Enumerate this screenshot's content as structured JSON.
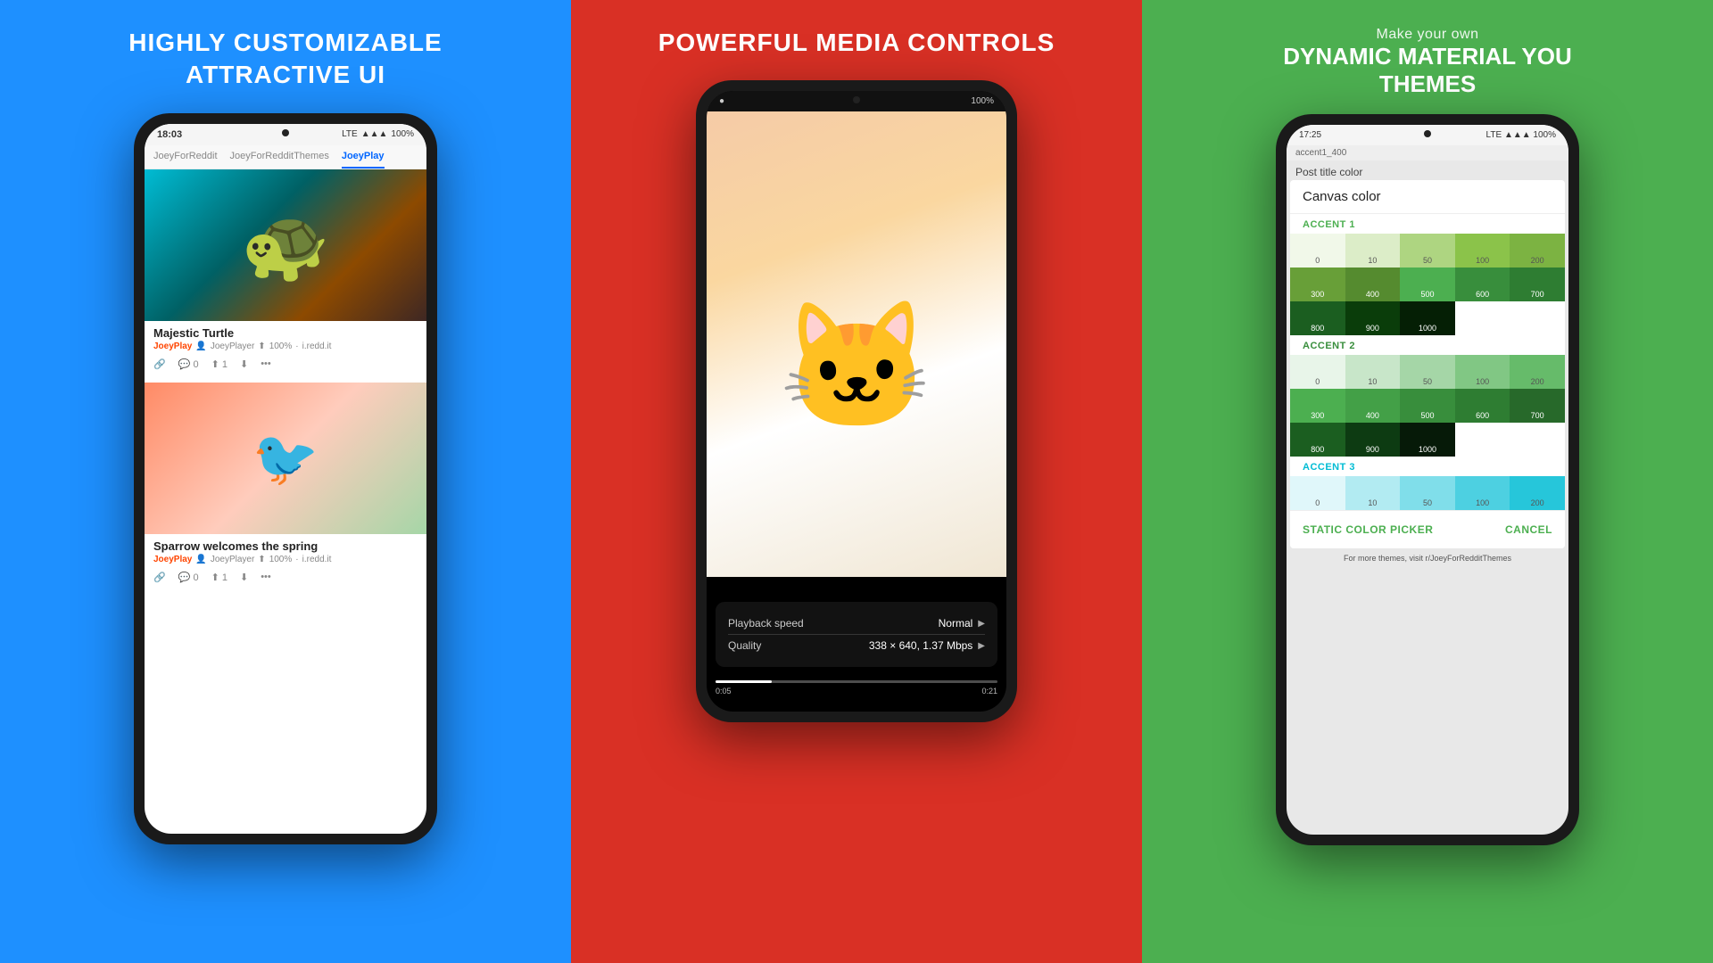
{
  "panel1": {
    "title_line1": "HIGHLY CUSTOMIZABLE",
    "title_line2": "ATTRACTIVE UI",
    "background_color": "#1E90FF",
    "phone": {
      "time": "18:03",
      "network": "LTE",
      "battery": "100%",
      "tabs": [
        "JoeyForReddit",
        "JoeyForRedditThemes",
        "JoeyPlay"
      ],
      "active_tab": "JoeyPlay",
      "posts": [
        {
          "title": "Majestic Turtle",
          "subreddit": "JoeyPlay",
          "author": "JoeyPlayer",
          "upvotes": "100%",
          "comments": "0",
          "arrows": "1",
          "domain": "i.redd.it",
          "image": "turtle"
        },
        {
          "title": "Sparrow welcomes the spring",
          "subreddit": "JoeyPlay",
          "author": "JoeyPlayer",
          "upvotes": "100%",
          "comments": "0",
          "arrows": "1",
          "domain": "i.redd.it",
          "image": "sparrow"
        }
      ]
    }
  },
  "panel2": {
    "title": "POWERFUL MEDIA CONTROLS",
    "background_color": "#D93025",
    "phone": {
      "battery": "100%",
      "media_overlay": {
        "playback_speed_label": "Playback speed",
        "playback_speed_value": "Normal",
        "quality_label": "Quality",
        "quality_value": "338 × 640, 1.37 Mbps"
      },
      "progress_time_start": "0:05",
      "progress_time_end": "0:21",
      "image": "cat"
    }
  },
  "panel3": {
    "title_top": "Make  your own",
    "title_main_line1": "DYNAMIC MATERIAL YOU",
    "title_main_line2": "THEMES",
    "background_color": "#4CAF50",
    "phone": {
      "time": "17:25",
      "network": "LTE",
      "battery": "100%",
      "breadcrumb": "accent1_400",
      "dialog": {
        "title": "Post title color",
        "canvas_label": "Canvas color",
        "accent1_label": "ACCENT 1",
        "accent1_values": [
          "0",
          "10",
          "50",
          "100",
          "200",
          "300",
          "400",
          "500",
          "600",
          "700",
          "800",
          "900",
          "1000"
        ],
        "accent2_label": "ACCENT 2",
        "accent2_values": [
          "0",
          "10",
          "50",
          "100",
          "200",
          "300",
          "400",
          "500",
          "600",
          "700",
          "800",
          "900",
          "1000"
        ],
        "accent3_label": "ACCENT 3",
        "accent3_values": [
          "0",
          "10",
          "50",
          "100",
          "200"
        ],
        "btn_static": "STATIC COLOR PICKER",
        "btn_cancel": "CANCEL"
      },
      "footer_note": "For more themes, visit r/JoeyForRedditThemes"
    }
  }
}
